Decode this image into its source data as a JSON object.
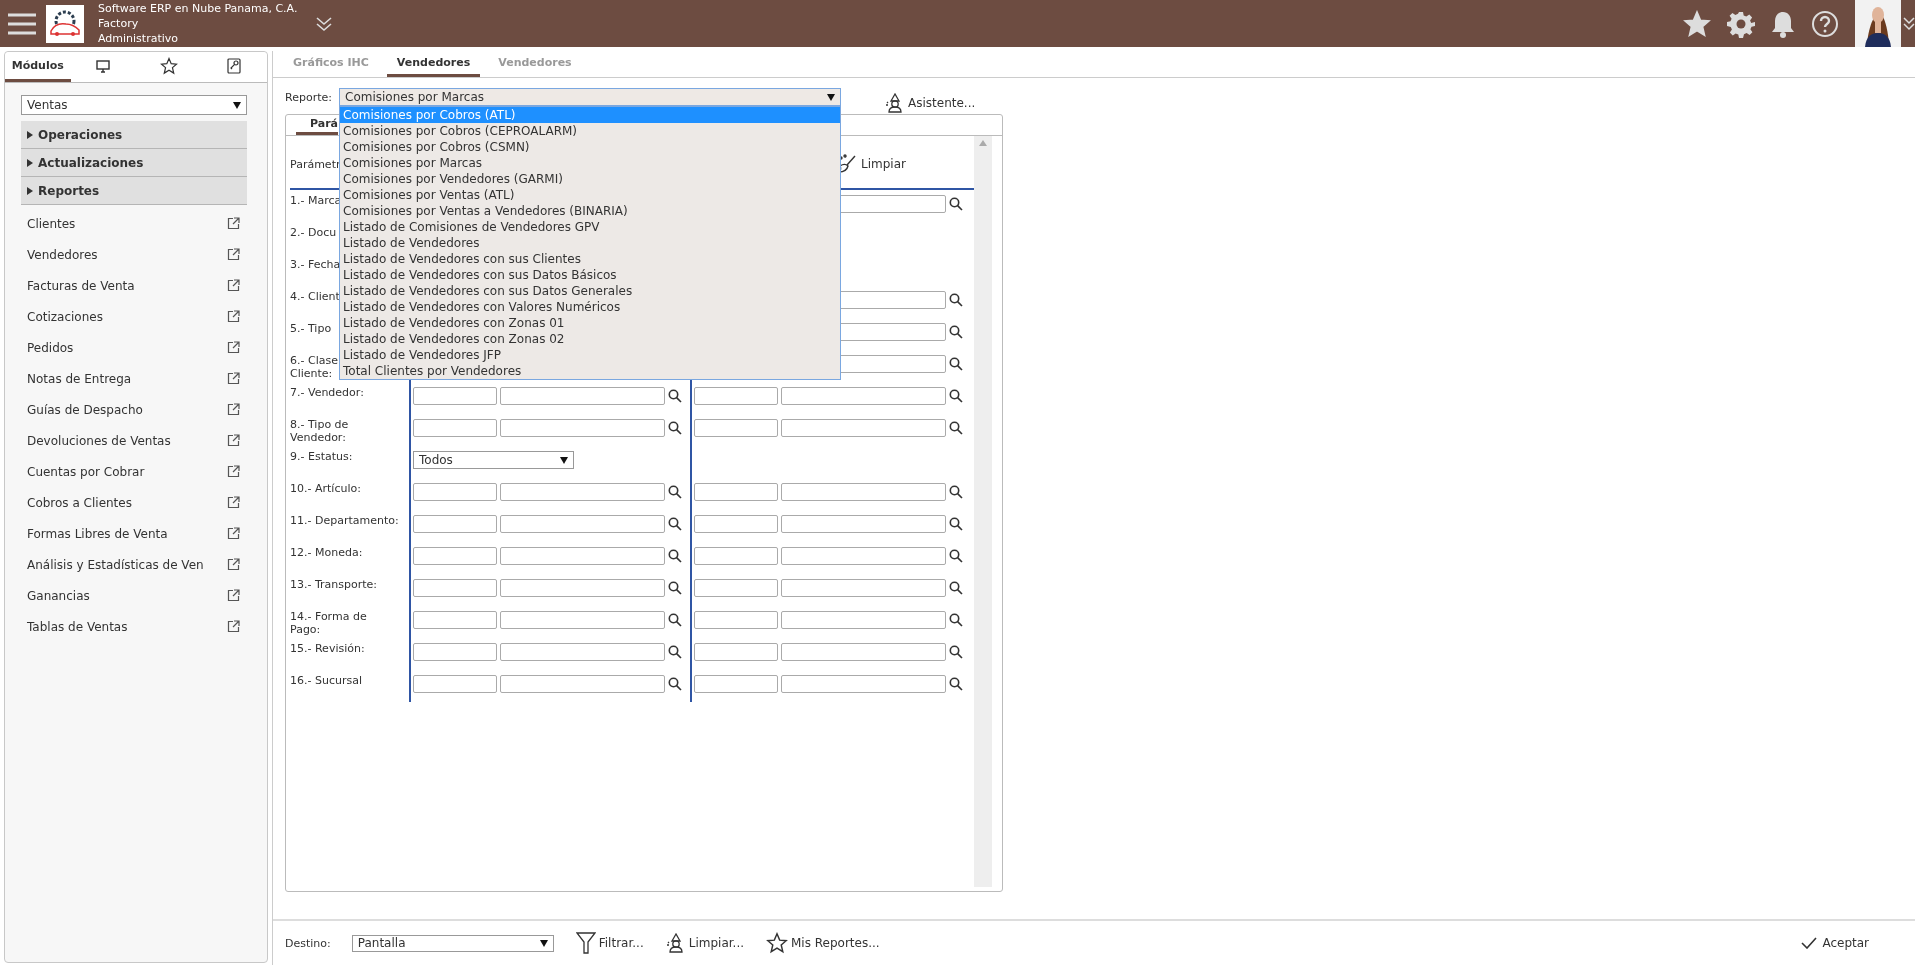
{
  "header": {
    "company": "Software ERP en Nube Panama, C.A.",
    "line2": "Factory",
    "line3": "Administrativo"
  },
  "sidebar": {
    "tabs": [
      {
        "kind": "text",
        "label": "Módulos",
        "selected": true
      },
      {
        "kind": "monitor",
        "selected": false
      },
      {
        "kind": "star",
        "selected": false
      },
      {
        "kind": "key",
        "selected": false
      }
    ],
    "module_select": "Ventas",
    "sections": [
      {
        "label": "Operaciones",
        "expanded": false
      },
      {
        "label": "Actualizaciones",
        "expanded": false
      },
      {
        "label": "Reportes",
        "expanded": false
      }
    ],
    "items": [
      "Clientes",
      "Vendedores",
      "Facturas de Venta",
      "Cotizaciones",
      "Pedidos",
      "Notas de Entrega",
      "Guías de Despacho",
      "Devoluciones de Ventas",
      "Cuentas por Cobrar",
      "Cobros a Clientes",
      "Formas Libres de Venta",
      "Análisis y Estadísticas de Ven",
      "Ganancias",
      "Tablas de Ventas"
    ]
  },
  "tabs": [
    {
      "label": "Gráficos IHC",
      "selected": false,
      "disabled": true
    },
    {
      "label": "Vendedores",
      "selected": true,
      "disabled": false
    },
    {
      "label": "Vendedores",
      "selected": false,
      "disabled": true
    }
  ],
  "report": {
    "label": "Reporte:",
    "value": "Comisiones por Marcas",
    "wizard": "Asistente...",
    "options": [
      {
        "label": "Comisiones por Cobros (ATL)",
        "highlighted": true
      },
      {
        "label": "Comisiones por Cobros (CEPROALARM)",
        "highlighted": false
      },
      {
        "label": "Comisiones por Cobros (CSMN)",
        "highlighted": false
      },
      {
        "label": "Comisiones por Marcas",
        "highlighted": false
      },
      {
        "label": "Comisiones por Vendedores (GARMI)",
        "highlighted": false
      },
      {
        "label": "Comisiones por Ventas (ATL)",
        "highlighted": false
      },
      {
        "label": "Comisiones por Ventas a Vendedores (BINARIA)",
        "highlighted": false
      },
      {
        "label": "Listado de Comisiones de Vendedores GPV",
        "highlighted": false
      },
      {
        "label": "Listado de Vendedores",
        "highlighted": false
      },
      {
        "label": "Listado de Vendedores con sus Clientes",
        "highlighted": false
      },
      {
        "label": "Listado de Vendedores con sus Datos Básicos",
        "highlighted": false
      },
      {
        "label": "Listado de Vendedores con sus Datos Generales",
        "highlighted": false
      },
      {
        "label": "Listado de Vendedores con Valores Numéricos",
        "highlighted": false
      },
      {
        "label": "Listado de Vendedores con Zonas 01",
        "highlighted": false
      },
      {
        "label": "Listado de Vendedores con Zonas 02",
        "highlighted": false
      },
      {
        "label": "Listado de Vendedores JFP",
        "highlighted": false
      },
      {
        "label": "Total Clientes por Vendedores",
        "highlighted": false
      }
    ]
  },
  "panel": {
    "tab": "Pará",
    "params_header": "Parámetr",
    "clear": "Limpiar",
    "rows": [
      {
        "label": "1.- Marca",
        "kind": "partial"
      },
      {
        "label": "2.- Docu",
        "kind": "hidden"
      },
      {
        "label": "3.- Fecha",
        "kind": "hidden"
      },
      {
        "label": "4.- Client",
        "kind": "partial"
      },
      {
        "label": "5.- Tipo",
        "kind": "partial"
      },
      {
        "label": "6.- Clase\nCliente:",
        "kind": "partial"
      },
      {
        "label": "7.- Vendedor:",
        "kind": "range"
      },
      {
        "label": "8.- Tipo de\nVendedor:",
        "kind": "range"
      },
      {
        "label": "9.- Estatus:",
        "kind": "select",
        "value": "Todos"
      },
      {
        "label": "10.- Artículo:",
        "kind": "range"
      },
      {
        "label": "11.- Departamento:",
        "kind": "range"
      },
      {
        "label": "12.- Moneda:",
        "kind": "range"
      },
      {
        "label": "13.- Transporte:",
        "kind": "range"
      },
      {
        "label": "14.- Forma de\nPago:",
        "kind": "range"
      },
      {
        "label": "15.- Revisión:",
        "kind": "range"
      },
      {
        "label": "16.- Sucursal",
        "kind": "range"
      }
    ]
  },
  "bottom": {
    "destino_label": "Destino:",
    "destino": "Pantalla",
    "actions": [
      {
        "kind": "filter",
        "label": "Filtrar..."
      },
      {
        "kind": "wizard",
        "label": "Limpiar..."
      },
      {
        "kind": "star",
        "label": "Mis Reportes..."
      }
    ],
    "accept": "Aceptar"
  }
}
